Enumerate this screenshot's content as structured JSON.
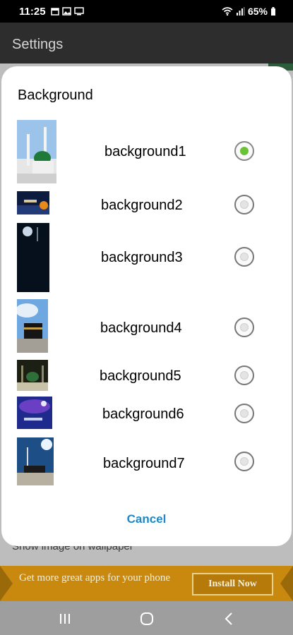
{
  "status_bar": {
    "time": "11:25",
    "battery": "65%"
  },
  "app_bar": {
    "title": "Settings"
  },
  "background_row": {
    "text": "Show image on wallpaper"
  },
  "ad": {
    "text": "Get more great apps for your phone",
    "button": "Install Now"
  },
  "dialog": {
    "title": "Background",
    "options": [
      {
        "label": "background1",
        "selected": true
      },
      {
        "label": "background2",
        "selected": false
      },
      {
        "label": "background3",
        "selected": false
      },
      {
        "label": "background4",
        "selected": false
      },
      {
        "label": "background5",
        "selected": false
      },
      {
        "label": "background6",
        "selected": false
      },
      {
        "label": "background7",
        "selected": false
      }
    ],
    "cancel": "Cancel"
  },
  "colors": {
    "accent": "#1e88c8",
    "radio_selected": "#6ac236",
    "ad_background": "#c8890e"
  },
  "icons": {
    "nav": [
      "recents-icon",
      "home-icon",
      "back-icon"
    ]
  }
}
